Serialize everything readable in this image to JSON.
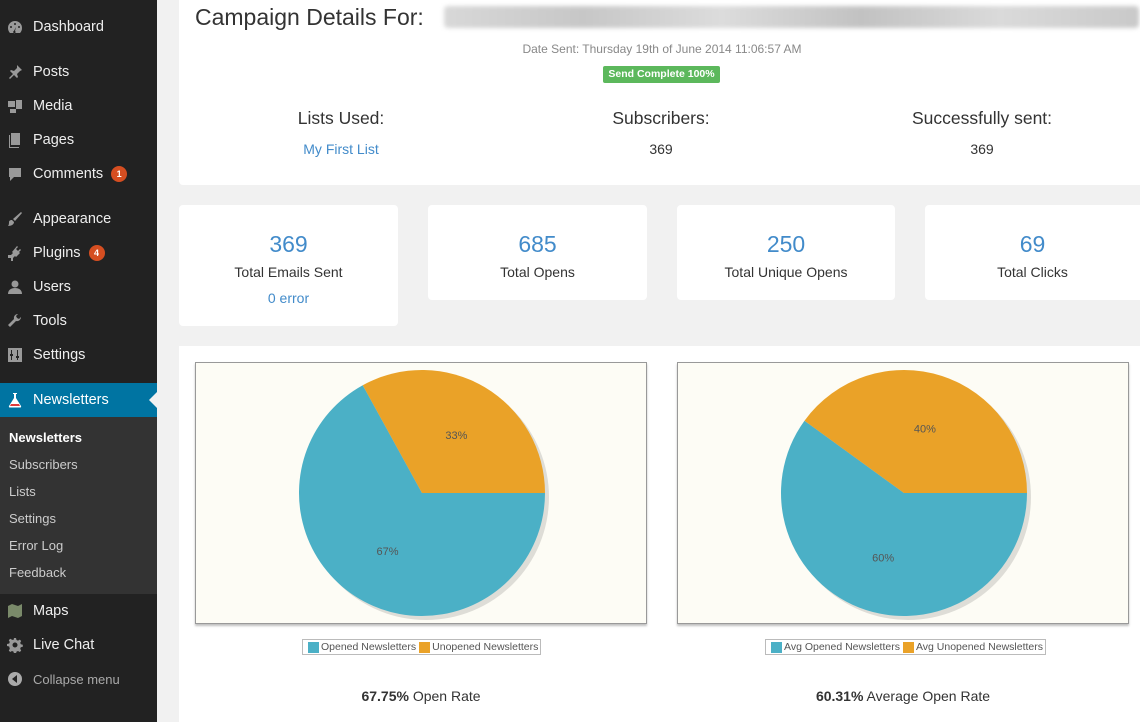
{
  "sidebar": {
    "menu": [
      {
        "id": "dashboard",
        "label": "Dashboard",
        "icon": "dashboard-icon"
      },
      {
        "id": "posts",
        "label": "Posts",
        "icon": "pin-icon"
      },
      {
        "id": "media",
        "label": "Media",
        "icon": "media-icon"
      },
      {
        "id": "pages",
        "label": "Pages",
        "icon": "pages-icon"
      },
      {
        "id": "comments",
        "label": "Comments",
        "icon": "comment-icon",
        "badge": "1"
      },
      {
        "id": "appearance",
        "label": "Appearance",
        "icon": "paintbrush-icon"
      },
      {
        "id": "plugins",
        "label": "Plugins",
        "icon": "plug-icon",
        "badge": "4"
      },
      {
        "id": "users",
        "label": "Users",
        "icon": "user-icon"
      },
      {
        "id": "tools",
        "label": "Tools",
        "icon": "wrench-icon"
      },
      {
        "id": "settings",
        "label": "Settings",
        "icon": "sliders-icon"
      },
      {
        "id": "newsletters",
        "label": "Newsletters",
        "icon": "flask-icon",
        "active": true
      }
    ],
    "submenu": [
      "Newsletters",
      "Subscribers",
      "Lists",
      "Settings",
      "Error Log",
      "Feedback"
    ],
    "menu_after": [
      {
        "id": "maps",
        "label": "Maps",
        "icon": "map-icon"
      },
      {
        "id": "livechat",
        "label": "Live Chat",
        "icon": "gear-icon"
      }
    ],
    "collapse_label": "Collapse menu"
  },
  "campaign": {
    "title": "Campaign Details For:",
    "date_sent": "Date Sent: Thursday 19th of June 2014 11:06:57 AM",
    "status_badge": "Send Complete 100%",
    "lists_used_label": "Lists Used:",
    "lists_used_value": "My First List",
    "subscribers_label": "Subscribers:",
    "subscribers_value": "369",
    "sent_label": "Successfully sent:",
    "sent_value": "369"
  },
  "cards": [
    {
      "value": "369",
      "label": "Total Emails Sent",
      "extra": "0 error"
    },
    {
      "value": "685",
      "label": "Total Opens"
    },
    {
      "value": "250",
      "label": "Total Unique Opens"
    },
    {
      "value": "69",
      "label": "Total Clicks"
    }
  ],
  "colors": {
    "opened": "#4bb0c6",
    "unopened": "#eaa228",
    "accent": "#0074a2",
    "link": "#428bca",
    "success": "#5cb85c"
  },
  "chart_data": [
    {
      "type": "pie",
      "slices": [
        {
          "name": "Opened Newsletters",
          "value": 67,
          "label": "67%",
          "color": "#4bb0c6"
        },
        {
          "name": "Unopened Newsletters",
          "value": 33,
          "label": "33%",
          "color": "#eaa228"
        }
      ],
      "legend": [
        "Opened Newsletters",
        "Unopened Newsletters"
      ],
      "rate_value": "67.75%",
      "rate_label": "Open Rate"
    },
    {
      "type": "pie",
      "slices": [
        {
          "name": "Avg Opened Newsletters",
          "value": 60,
          "label": "60%",
          "color": "#4bb0c6"
        },
        {
          "name": "Avg Unopened Newsletters",
          "value": 40,
          "label": "40%",
          "color": "#eaa228"
        }
      ],
      "legend": [
        "Avg Opened Newsletters",
        "Avg Unopened Newsletters"
      ],
      "rate_value": "60.31%",
      "rate_label": "Average Open Rate"
    }
  ]
}
